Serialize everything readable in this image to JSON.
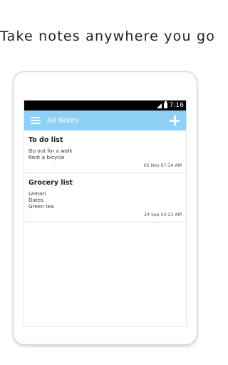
{
  "headline": "Take notes anywhere you go",
  "status": {
    "time": "7:16",
    "icons": [
      "signal-icon",
      "battery-icon"
    ]
  },
  "appbar": {
    "title": "All Notes",
    "menu_icon": "menu-icon",
    "add_icon": "plus-icon",
    "color": "#8fd0f6"
  },
  "notes": [
    {
      "title": "To do list",
      "lines": [
        "Go out for a walk",
        "Rent a bicycle"
      ],
      "date": "05 Nov 07:14 AM"
    },
    {
      "title": "Grocery list",
      "lines": [
        "Lemon",
        "Dates",
        "Green tea"
      ],
      "date": "24 Sep 03:21 AM"
    }
  ]
}
